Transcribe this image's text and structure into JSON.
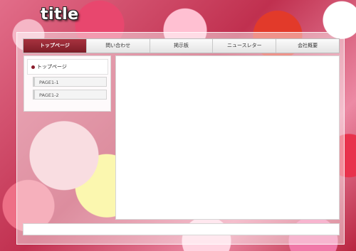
{
  "site": {
    "logo": "title"
  },
  "nav": {
    "items": [
      {
        "label": "トップページ"
      },
      {
        "label": "問い合わせ"
      },
      {
        "label": "掲示板"
      },
      {
        "label": "ニュースレター"
      },
      {
        "label": "会社概要"
      }
    ],
    "active_index": 0
  },
  "sidebar": {
    "top": "トップページ",
    "sub": [
      "PAGE1-1",
      "PAGE1-2"
    ]
  },
  "colors": {
    "accent": "#8a1c2b",
    "nav_active": "#a8323f"
  }
}
